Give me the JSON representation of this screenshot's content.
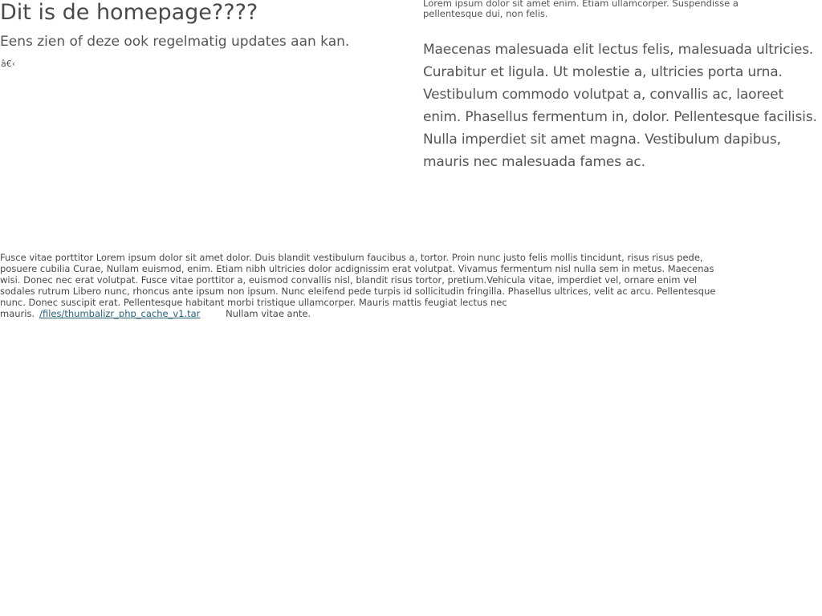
{
  "header": {
    "title": "Dit is de homepage????",
    "subtitle": "Eens zien of deze ook regelmatig updates aan kan.",
    "glyph_text": "â€‹"
  },
  "sidebar": {
    "intro_small": "Lorem ipsum dolor sit amet enim. Etiam ullamcorper. Suspendisse a pellentesque dui, non felis.",
    "intro_large": "Maecenas malesuada elit lectus felis, malesuada ultricies. Curabitur et ligula. Ut molestie a, ultricies porta urna. Vestibulum commodo volutpat a, convallis ac, laoreet enim. Phasellus fermentum in, dolor. Pellentesque facilisis. Nulla imperdiet sit amet magna. Vestibulum dapibus, mauris nec malesuada fames ac."
  },
  "body": {
    "paragraph_before_link": "Fusce vitae porttitor Lorem ipsum dolor sit amet dolor. Duis blandit vestibulum faucibus a, tortor. Proin nunc justo felis mollis tincidunt, risus risus pede, posuere cubilia Curae, Nullam euismod, enim. Etiam nibh ultricies dolor acdignissim erat volutpat. Vivamus fermentum nisl nulla sem in metus. Maecenas wisi. Donec nec erat volutpat. Fusce vitae porttitor a, euismod convallis nisl, blandit risus tortor, pretium.Vehicula vitae, imperdiet vel, ornare enim vel sodales rutrum Libero nunc, rhoncus ante ipsum non ipsum. Nunc eleifend pede turpis id sollicitudin fringilla. Phasellus ultrices, velit ac arcu. Pellentesque nunc. Donec suscipit erat. Pellentesque habitant morbi tristique ullamcorper. Mauris mattis feugiat lectus nec mauris.",
    "link_text": "/files/thumbalizr_php_cache_v1.tar",
    "paragraph_after_link": " Nullam vitae ante."
  }
}
